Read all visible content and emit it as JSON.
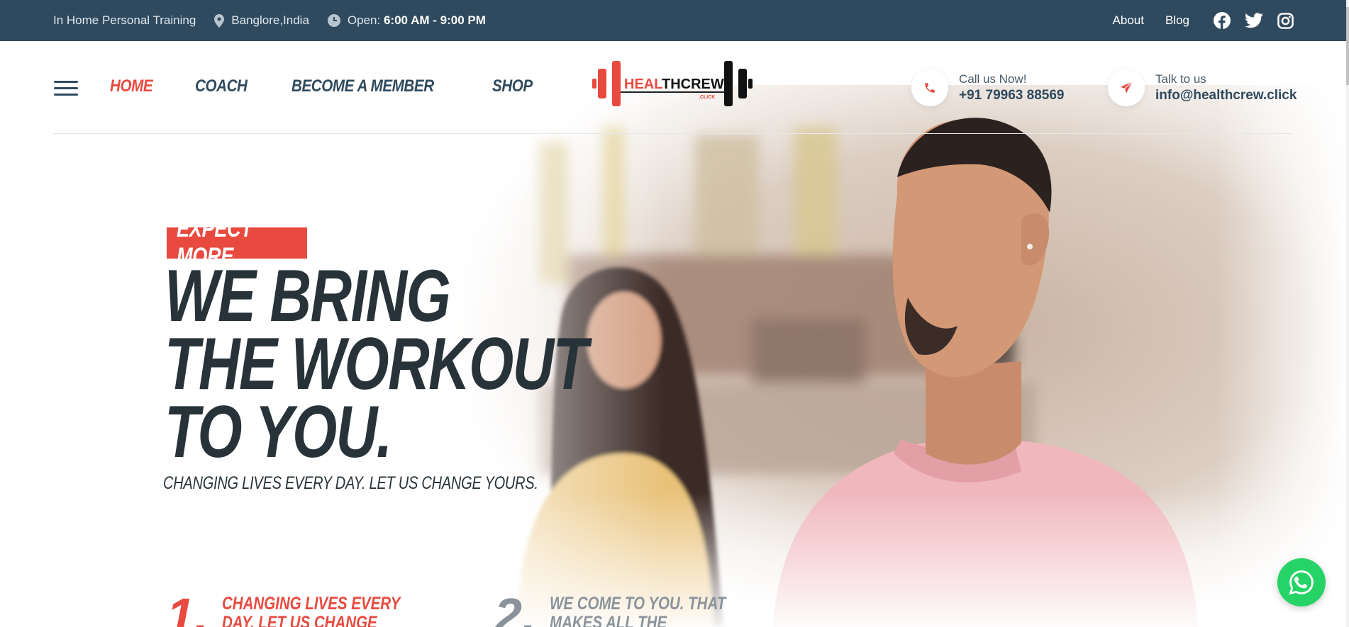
{
  "topbar": {
    "service": "In Home Personal Training",
    "location": "Banglore,India",
    "hours_label": "Open:",
    "hours_value": "6:00 AM - 9:00 PM",
    "links": [
      "About",
      "Blog"
    ],
    "social_icons": [
      "facebook-icon",
      "twitter-icon",
      "instagram-icon"
    ]
  },
  "nav": {
    "items": [
      "HOME",
      "COACH",
      "BECOME A MEMBER",
      "SHOP"
    ],
    "active": "HOME"
  },
  "logo": {
    "brand_red": "HEAL",
    "brand_dark": "THCREW",
    "suffix": ".CLICK"
  },
  "contact": {
    "phone_label": "Call us Now!",
    "phone": "+91 79963 88569",
    "email_label": "Talk to us",
    "email": "info@healthcrew.click"
  },
  "hero": {
    "tag": "EXPECT MORE",
    "headline": [
      "WE BRING",
      "THE WORKOUT",
      "TO YOU."
    ],
    "subline": "CHANGING LIVES EVERY DAY. LET US CHANGE YOURS."
  },
  "features": [
    {
      "num": "1.",
      "text": "CHANGING LIVES EVERY DAY. LET US CHANGE YOURS"
    },
    {
      "num": "2.",
      "text": "WE COME TO YOU. THAT MAKES ALL THE DIFFERENCE"
    }
  ],
  "colors": {
    "topbar": "#2f4a5e",
    "accent": "#e84a3f",
    "heading": "#283339",
    "whatsapp": "#25d366"
  }
}
